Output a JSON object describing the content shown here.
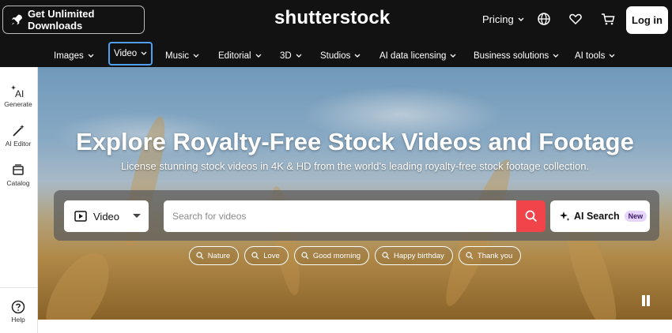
{
  "header": {
    "download_label": "Get Unlimited Downloads",
    "logo_text": "shutterstock",
    "pricing_label": "Pricing",
    "login_label": "Log in"
  },
  "nav": {
    "items": [
      {
        "label": "Images",
        "active": false
      },
      {
        "label": "Video",
        "active": true
      },
      {
        "label": "Music",
        "active": false
      },
      {
        "label": "Editorial",
        "active": false
      },
      {
        "label": "3D",
        "active": false
      },
      {
        "label": "Studios",
        "active": false
      },
      {
        "label": "AI data licensing",
        "active": false
      },
      {
        "label": "Business solutions",
        "active": false
      },
      {
        "label": "AI tools",
        "active": false
      }
    ]
  },
  "sidebar": {
    "items": [
      {
        "label": "Generate",
        "icon": "ai-sparkle-icon"
      },
      {
        "label": "AI Editor",
        "icon": "magic-wand-icon"
      },
      {
        "label": "Catalog",
        "icon": "catalog-icon"
      }
    ],
    "help_label": "Help"
  },
  "hero": {
    "title": "Explore Royalty-Free Stock Videos and Footage",
    "subtitle": "License stunning stock videos in 4K & HD from the world's leading royalty-free stock footage collection.",
    "search": {
      "type_selected": "Video",
      "placeholder": "Search for videos",
      "value": "",
      "ai_search_label": "AI Search",
      "new_badge": "New"
    },
    "chips": [
      "Nature",
      "Love",
      "Good morning",
      "Happy birthday",
      "Thank you"
    ]
  },
  "colors": {
    "header_bg": "#121212",
    "search_button": "#f1434a",
    "active_nav_outline": "#4f9ff5",
    "new_badge_bg": "#e6d4fb"
  }
}
